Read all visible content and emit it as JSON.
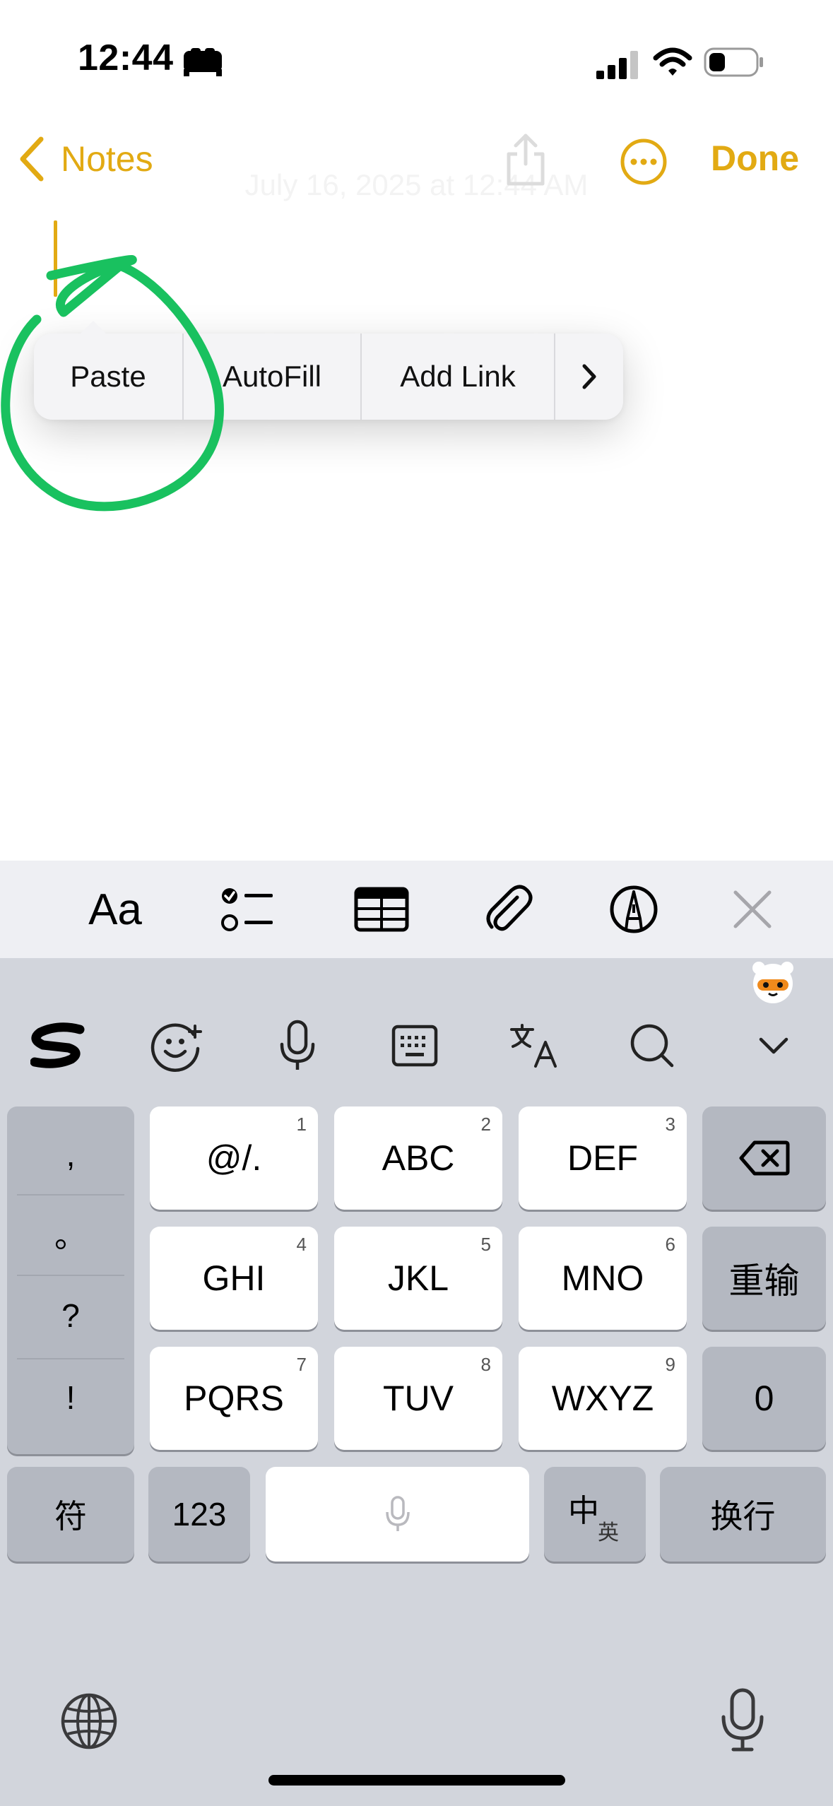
{
  "status_bar": {
    "time": "12:44"
  },
  "nav": {
    "back_label": "Notes",
    "done_label": "Done"
  },
  "note": {
    "date_faded": "July 16, 2025 at 12:44 AM"
  },
  "context_menu": {
    "items": [
      "Paste",
      "AutoFill",
      "Add Link"
    ],
    "more": "›"
  },
  "format_toolbar": {
    "text_style_label": "Aa",
    "items": [
      "text-style",
      "checklist",
      "table",
      "attachment",
      "markup",
      "close"
    ]
  },
  "ime_toolbar": {
    "items": [
      "sogou-logo",
      "emoji",
      "voice",
      "keyboard-switch",
      "translate",
      "search",
      "collapse"
    ]
  },
  "keyboard": {
    "punctuation": [
      ",",
      "。",
      "?",
      "!"
    ],
    "keys": [
      {
        "label": "@/.",
        "sub": "1"
      },
      {
        "label": "ABC",
        "sub": "2"
      },
      {
        "label": "DEF",
        "sub": "3"
      },
      {
        "label": "GHI",
        "sub": "4"
      },
      {
        "label": "JKL",
        "sub": "5"
      },
      {
        "label": "MNO",
        "sub": "6"
      },
      {
        "label": "PQRS",
        "sub": "7"
      },
      {
        "label": "TUV",
        "sub": "8"
      },
      {
        "label": "WXYZ",
        "sub": "9"
      }
    ],
    "reinput_label": "重输",
    "zero_label": "0",
    "symbols_label": "符",
    "numbers_label": "123",
    "lang_main": "中",
    "lang_sub": "英",
    "return_label": "换行"
  },
  "colors": {
    "accent": "#e2aa13",
    "annotation_stroke": "#19c15f",
    "keyboard_bg": "#d2d5dc",
    "key_gray": "#b4b8c1"
  }
}
